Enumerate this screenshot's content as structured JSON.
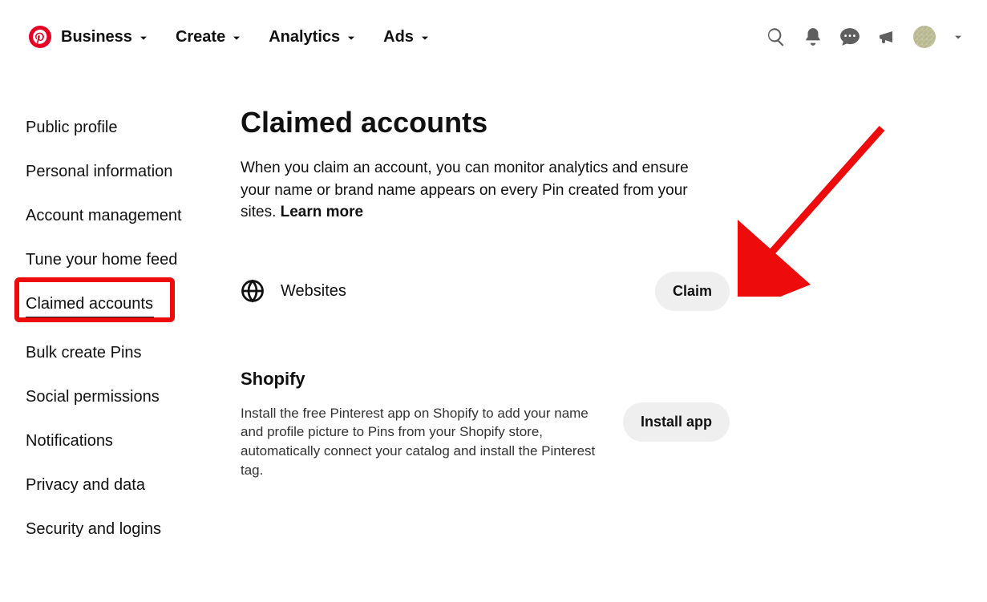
{
  "header": {
    "nav": {
      "business": "Business",
      "create": "Create",
      "analytics": "Analytics",
      "ads": "Ads"
    }
  },
  "sidebar": {
    "items": [
      "Public profile",
      "Personal information",
      "Account management",
      "Tune your home feed",
      "Claimed accounts",
      "Bulk create Pins",
      "Social permissions",
      "Notifications",
      "Privacy and data",
      "Security and logins"
    ]
  },
  "main": {
    "title": "Claimed accounts",
    "description": "When you claim an account, you can monitor analytics and ensure your name or brand name appears on every Pin created from your sites. ",
    "learn_more": "Learn more",
    "websites": {
      "label": "Websites",
      "button": "Claim"
    },
    "shopify": {
      "title": "Shopify",
      "description": "Install the free Pinterest app on Shopify to add your name and profile picture to Pins from your Shopify store, automatically connect your catalog and install the Pinterest tag.",
      "button": "Install app"
    }
  }
}
